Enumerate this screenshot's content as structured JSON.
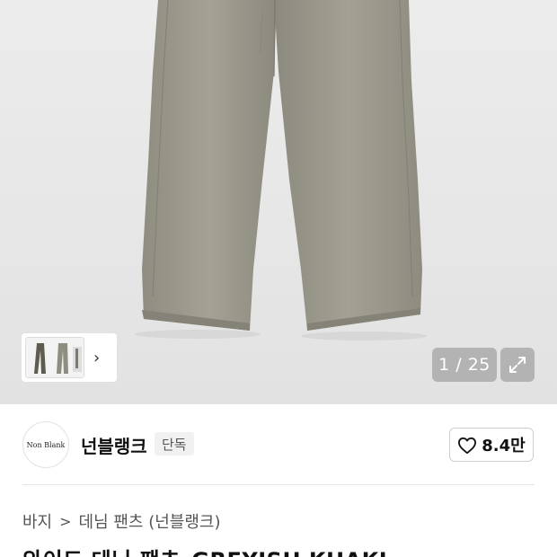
{
  "gallery": {
    "counter": "1 / 25",
    "expand_icon": "expand-arrows-icon",
    "thumbnail_more_icon": "chevron-right-icon"
  },
  "brand": {
    "logo_text": "Non Blank",
    "name": "넌블랭크",
    "badge": "단독"
  },
  "like": {
    "icon": "heart-icon",
    "count": "8.4만"
  },
  "breadcrumb": {
    "items": [
      "바지",
      "데님 팬츠 (넌블랭크)"
    ]
  },
  "product": {
    "title": "와이드 데님 팬츠_GREYISH KHAKI"
  },
  "colors": {
    "denim": "#9a988a",
    "hero_bg": "#e6e6e6"
  }
}
